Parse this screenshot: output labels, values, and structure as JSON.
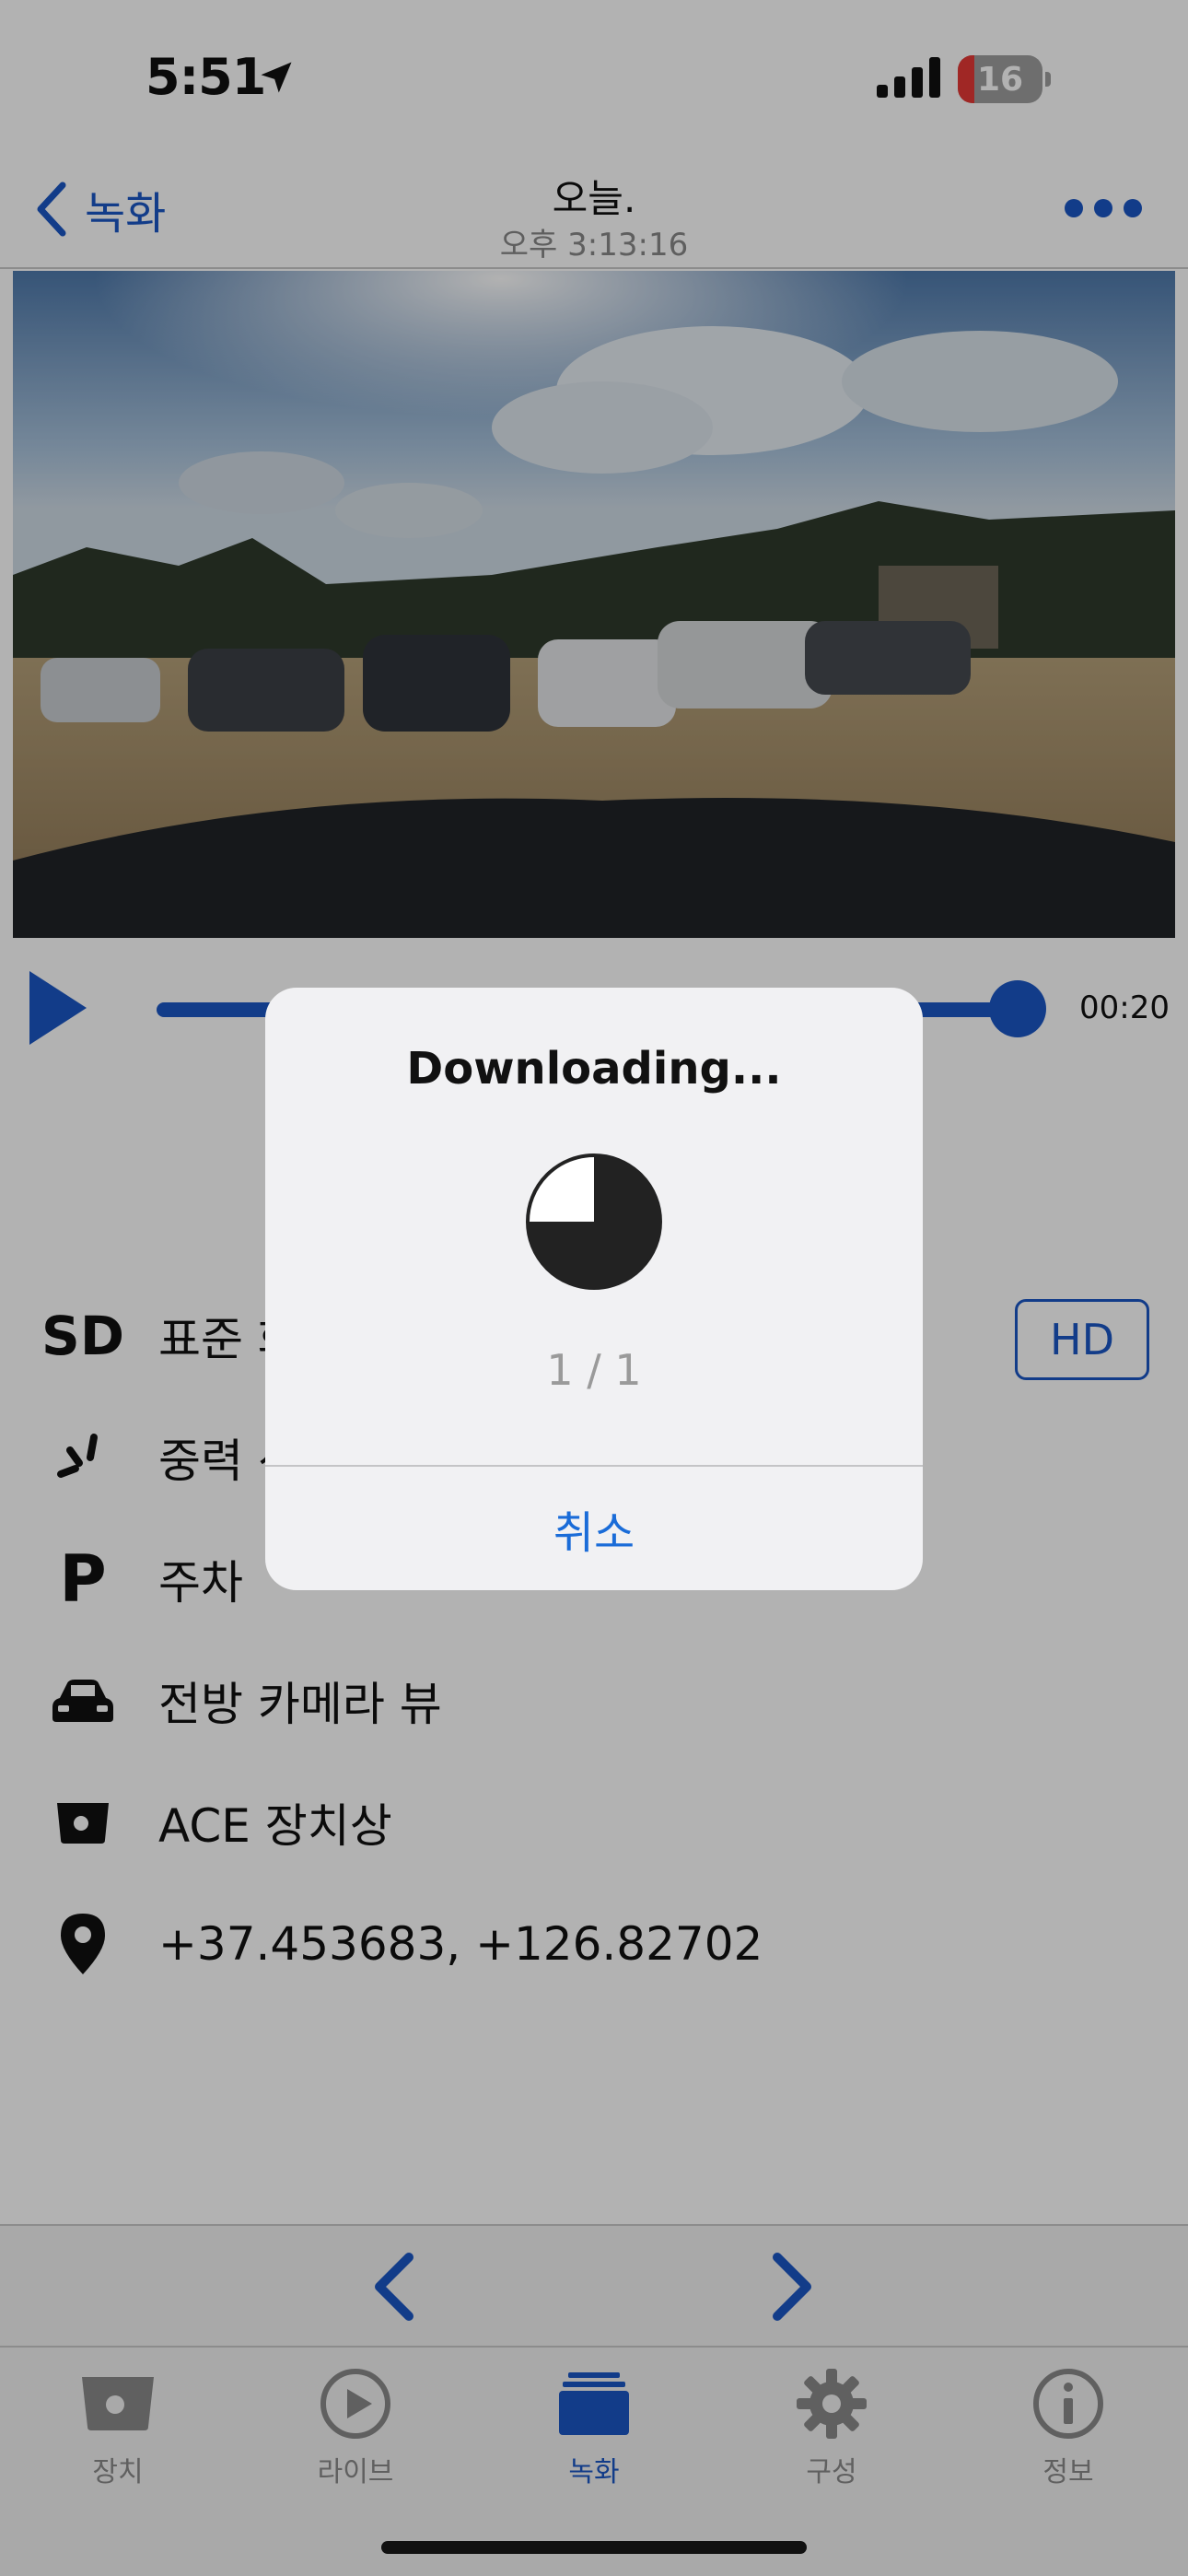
{
  "status_bar": {
    "time": "5:51",
    "battery_level": "16"
  },
  "nav": {
    "back_label": "녹화",
    "title": "오늘.",
    "subtitle": "오후 3:13:16"
  },
  "player": {
    "time": "00:20",
    "progress": 1.0
  },
  "info": {
    "quality_badge": "SD",
    "quality_label": "표준 화질",
    "quality_toggle": "HD",
    "event_label": "중력 센서",
    "parking_badge": "P",
    "parking_label": "주차",
    "camera_label": "전방 카메라 뷰",
    "device_label": "ACE 장치상",
    "location_label": "+37.453683, +126.82702"
  },
  "tabs": [
    {
      "label": "장치",
      "icon": "device-icon"
    },
    {
      "label": "라이브",
      "icon": "play-circle-icon"
    },
    {
      "label": "녹화",
      "icon": "recordings-stack-icon"
    },
    {
      "label": "구성",
      "icon": "gear-icon"
    },
    {
      "label": "정보",
      "icon": "info-icon"
    }
  ],
  "dialog": {
    "title": "Downloading...",
    "count": "1 / 1",
    "cancel_label": "취소",
    "progress": 0.75
  },
  "colors": {
    "accent": "#1a56c4",
    "dialog_cancel": "#1a6cd8",
    "battery_low": "#e53935"
  }
}
